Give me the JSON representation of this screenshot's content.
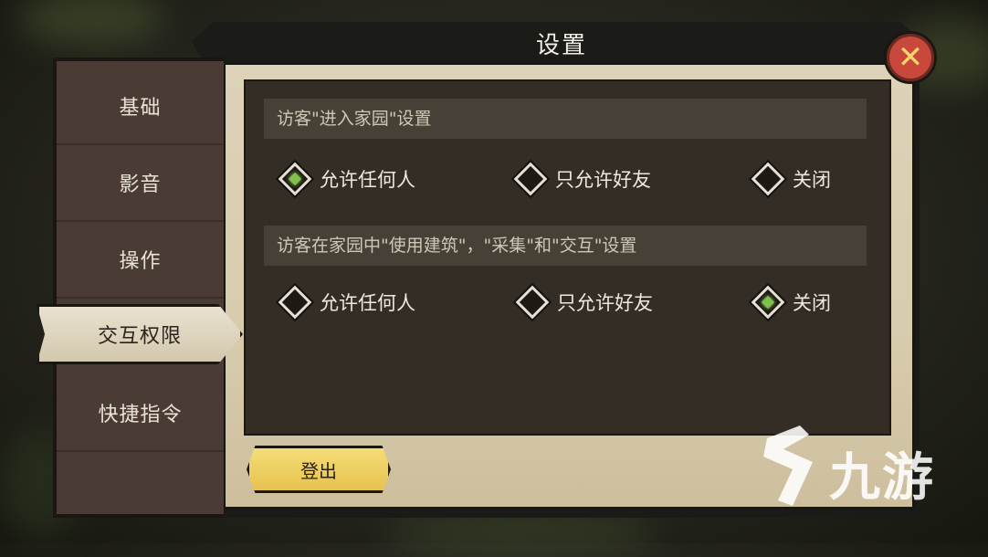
{
  "window": {
    "title": "设置"
  },
  "sidebar": {
    "items": [
      {
        "label": "基础"
      },
      {
        "label": "影音"
      },
      {
        "label": "操作"
      },
      {
        "label": "交互权限",
        "active": true
      },
      {
        "label": "快捷指令"
      }
    ]
  },
  "sections": [
    {
      "header": "访客\"进入家园\"设置",
      "options": [
        {
          "label": "允许任何人",
          "selected": true
        },
        {
          "label": "只允许好友",
          "selected": false
        },
        {
          "label": "关闭",
          "selected": false
        }
      ]
    },
    {
      "header": "访客在家园中\"使用建筑\"，\"采集\"和\"交互\"设置",
      "options": [
        {
          "label": "允许任何人",
          "selected": false
        },
        {
          "label": "只允许好友",
          "selected": false
        },
        {
          "label": "关闭",
          "selected": true
        }
      ]
    }
  ],
  "buttons": {
    "logout": "登出",
    "close_icon": "close-icon"
  },
  "watermark": {
    "text": "九游"
  },
  "colors": {
    "selected": "#7fc24a",
    "logout_button": "#f0d060",
    "close_button": "#c9483c"
  }
}
